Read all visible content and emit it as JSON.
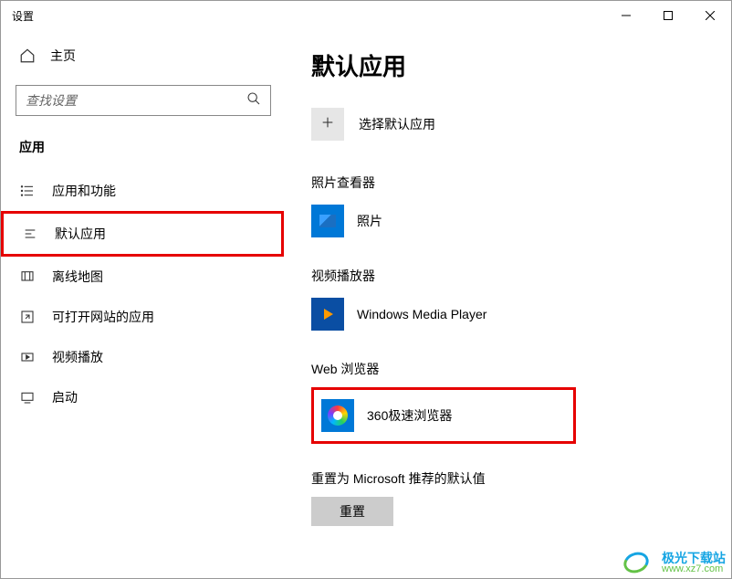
{
  "window": {
    "title": "设置"
  },
  "sidebar": {
    "home": "主页",
    "search_placeholder": "查找设置",
    "category": "应用",
    "items": [
      {
        "label": "应用和功能"
      },
      {
        "label": "默认应用"
      },
      {
        "label": "离线地图"
      },
      {
        "label": "可打开网站的应用"
      },
      {
        "label": "视频播放"
      },
      {
        "label": "启动"
      }
    ]
  },
  "main": {
    "title": "默认应用",
    "choose_label": "选择默认应用",
    "sections": {
      "photo_viewer": {
        "title": "照片查看器",
        "app": "照片"
      },
      "video_player": {
        "title": "视频播放器",
        "app": "Windows Media Player"
      },
      "web_browser": {
        "title": "Web 浏览器",
        "app": "360极速浏览器"
      }
    },
    "reset_label": "重置为 Microsoft 推荐的默认值",
    "reset_button": "重置"
  },
  "watermark": {
    "line1": "极光下载站",
    "line2": "www.xz7.com"
  }
}
